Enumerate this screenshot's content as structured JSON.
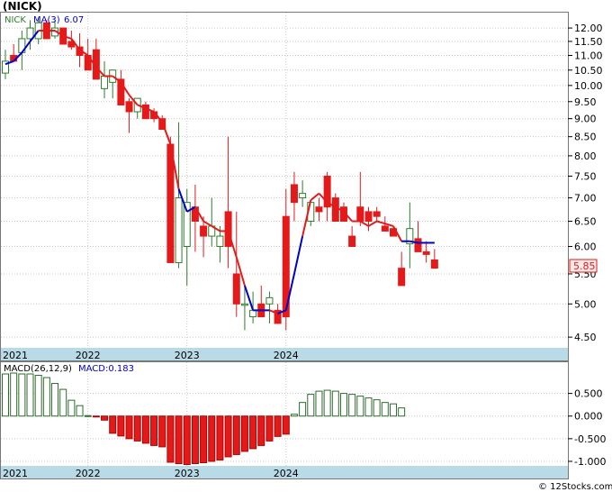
{
  "ticker_label": "(NICK)",
  "price_panel": {
    "legend_symbol": "NICK",
    "legend_ma": "MA(3)",
    "legend_ma_value": "6.07",
    "last_price": "5.85",
    "y_tick_labels": [
      "12.00",
      "11.50",
      "11.00",
      "10.50",
      "10.00",
      "9.50",
      "9.00",
      "8.50",
      "8.00",
      "7.50",
      "7.00",
      "6.50",
      "6.00",
      "5.50",
      "5.00",
      "4.50"
    ]
  },
  "macd_panel": {
    "legend_params": "MACD(26,12,9)",
    "legend_value": "MACD:0.183",
    "y_tick_labels": [
      "0.500",
      "0.000",
      "-0.500",
      "-1.000"
    ]
  },
  "x_axis_labels": [
    "2021",
    "2022",
    "2023",
    "2024"
  ],
  "watermark": "© 12Stocks.com",
  "colors": {
    "up": "#2e7d2e",
    "down": "#e41a1a",
    "ma_up": "#0000cc",
    "ma_down": "#e41a1a",
    "axis_band": "#b9dbe8",
    "macd_bar": "#2e6b2e"
  },
  "chart_data": [
    {
      "type": "candlestick",
      "scale": "log",
      "ylim": [
        4.35,
        12.6
      ],
      "x": [
        "2021-03",
        "2021-04",
        "2021-05",
        "2021-06",
        "2021-07",
        "2021-08",
        "2021-09",
        "2021-10",
        "2021-11",
        "2021-12",
        "2022-01",
        "2022-02",
        "2022-03",
        "2022-04",
        "2022-05",
        "2022-06",
        "2022-07",
        "2022-08",
        "2022-09",
        "2022-10",
        "2022-11",
        "2022-12",
        "2023-01",
        "2023-02",
        "2023-03",
        "2023-04",
        "2023-05",
        "2023-06",
        "2023-07",
        "2023-08",
        "2023-09",
        "2023-10",
        "2023-11",
        "2023-12",
        "2024-01",
        "2024-02",
        "2024-03",
        "2024-04",
        "2024-05",
        "2024-06",
        "2024-07",
        "2024-08",
        "2024-09",
        "2024-10",
        "2024-11",
        "2024-12",
        "2025-01",
        "2025-02",
        "2025-03",
        "2025-04",
        "2025-05",
        "2025-06",
        "2025-07"
      ],
      "open": [
        10.4,
        11.0,
        11.1,
        11.6,
        11.6,
        12.2,
        11.7,
        12.0,
        11.5,
        11.3,
        11.0,
        11.2,
        9.9,
        10.1,
        10.2,
        9.5,
        9.2,
        9.4,
        9.2,
        9.0,
        8.3,
        5.7,
        6.0,
        6.8,
        6.4,
        6.2,
        6.0,
        6.7,
        5.5,
        5.0,
        4.8,
        5.0,
        5.0,
        4.9,
        6.6,
        7.3,
        7.0,
        6.5,
        6.8,
        7.5,
        7.0,
        6.8,
        6.2,
        6.8,
        6.7,
        6.7,
        6.4,
        6.35,
        5.6,
        6.05,
        6.15,
        5.9,
        5.75
      ],
      "high": [
        11.2,
        11.4,
        11.9,
        12.3,
        12.4,
        12.3,
        12.3,
        12.0,
        11.9,
        11.8,
        11.6,
        11.6,
        10.8,
        10.3,
        10.5,
        9.6,
        9.5,
        9.5,
        9.3,
        9.1,
        8.5,
        8.9,
        7.2,
        7.3,
        6.6,
        7.0,
        6.4,
        8.5,
        6.7,
        5.3,
        5.2,
        5.3,
        5.2,
        5.0,
        7.2,
        7.6,
        7.4,
        6.9,
        7.0,
        7.6,
        7.1,
        6.9,
        6.4,
        7.6,
        6.8,
        6.8,
        6.6,
        6.4,
        5.9,
        6.9,
        6.5,
        6.1,
        5.95
      ],
      "low": [
        10.2,
        10.8,
        10.5,
        11.2,
        11.4,
        11.8,
        11.6,
        11.8,
        11.2,
        10.6,
        10.5,
        10.8,
        9.6,
        9.6,
        9.7,
        8.6,
        9.0,
        9.0,
        8.9,
        8.8,
        8.2,
        5.6,
        5.3,
        5.9,
        5.8,
        6.0,
        5.7,
        5.6,
        4.8,
        4.6,
        4.7,
        4.8,
        4.7,
        4.7,
        4.6,
        6.5,
        6.8,
        6.4,
        6.5,
        6.5,
        6.7,
        6.5,
        6.0,
        6.4,
        6.3,
        6.5,
        6.3,
        6.2,
        5.3,
        5.6,
        5.9,
        5.7,
        5.6
      ],
      "close": [
        10.8,
        10.8,
        11.6,
        12.0,
        12.2,
        11.6,
        12.0,
        11.4,
        11.3,
        11.0,
        10.5,
        10.2,
        10.3,
        10.5,
        9.4,
        9.2,
        9.6,
        9.0,
        9.0,
        8.7,
        5.7,
        7.0,
        6.9,
        6.5,
        6.2,
        6.4,
        6.2,
        6.0,
        5.0,
        5.0,
        4.9,
        4.8,
        5.1,
        4.7,
        4.8,
        6.9,
        7.1,
        6.9,
        6.7,
        6.8,
        6.5,
        6.5,
        6.0,
        6.5,
        6.5,
        6.6,
        6.3,
        6.2,
        5.3,
        6.35,
        5.9,
        5.85,
        5.6
      ],
      "ma": [
        10.7,
        10.8,
        11.1,
        11.5,
        11.9,
        11.9,
        11.9,
        11.7,
        11.6,
        11.2,
        11.0,
        10.6,
        10.3,
        10.3,
        10.1,
        9.7,
        9.4,
        9.3,
        9.2,
        8.9,
        8.3,
        7.2,
        6.7,
        6.8,
        6.5,
        6.4,
        6.3,
        6.3,
        5.8,
        5.3,
        4.9,
        4.9,
        4.9,
        4.85,
        4.9,
        5.5,
        6.2,
        6.95,
        7.1,
        6.9,
        6.8,
        6.7,
        6.5,
        6.5,
        6.4,
        6.5,
        6.45,
        6.4,
        6.1,
        6.1,
        6.07,
        6.07,
        6.07
      ],
      "ma_trend": [
        "up",
        "up",
        "up",
        "up",
        "up",
        "down",
        "down",
        "down",
        "down",
        "down",
        "down",
        "down",
        "down",
        "down",
        "down",
        "down",
        "down",
        "down",
        "down",
        "down",
        "down",
        "down",
        "up",
        "up",
        "down",
        "down",
        "down",
        "down",
        "down",
        "down",
        "up",
        "up",
        "up",
        "down",
        "up",
        "up",
        "up",
        "down",
        "down",
        "down",
        "down",
        "down",
        "down",
        "down",
        "down",
        "down",
        "down",
        "down",
        "down",
        "up",
        "up",
        "up",
        "up"
      ]
    },
    {
      "type": "bar",
      "name": "MACD(26,12,9)",
      "ylim": [
        -1.1,
        0.95
      ],
      "x": [
        "2021-03",
        "2021-04",
        "2021-05",
        "2021-06",
        "2021-07",
        "2021-08",
        "2021-09",
        "2021-10",
        "2021-11",
        "2021-12",
        "2022-01",
        "2022-02",
        "2022-03",
        "2022-04",
        "2022-05",
        "2022-06",
        "2022-07",
        "2022-08",
        "2022-09",
        "2022-10",
        "2022-11",
        "2022-12",
        "2023-01",
        "2023-02",
        "2023-03",
        "2023-04",
        "2023-05",
        "2023-06",
        "2023-07",
        "2023-08",
        "2023-09",
        "2023-10",
        "2023-11",
        "2023-12",
        "2024-01",
        "2024-02",
        "2024-03",
        "2024-04",
        "2024-05",
        "2024-06",
        "2024-07",
        "2024-08",
        "2024-09",
        "2024-10",
        "2024-11",
        "2024-12",
        "2025-01",
        "2025-02",
        "2025-03"
      ],
      "values": [
        0.93,
        0.95,
        0.93,
        0.93,
        0.9,
        0.85,
        0.72,
        0.59,
        0.35,
        0.23,
        0.01,
        -0.02,
        -0.09,
        -0.38,
        -0.44,
        -0.5,
        -0.55,
        -0.6,
        -0.65,
        -0.68,
        -1.02,
        -1.05,
        -1.07,
        -1.05,
        -1.03,
        -1.0,
        -0.97,
        -0.9,
        -0.85,
        -0.78,
        -0.72,
        -0.65,
        -0.55,
        -0.45,
        -0.4,
        0.04,
        0.3,
        0.48,
        0.55,
        0.57,
        0.55,
        0.5,
        0.48,
        0.44,
        0.4,
        0.36,
        0.3,
        0.27,
        0.18
      ]
    }
  ]
}
